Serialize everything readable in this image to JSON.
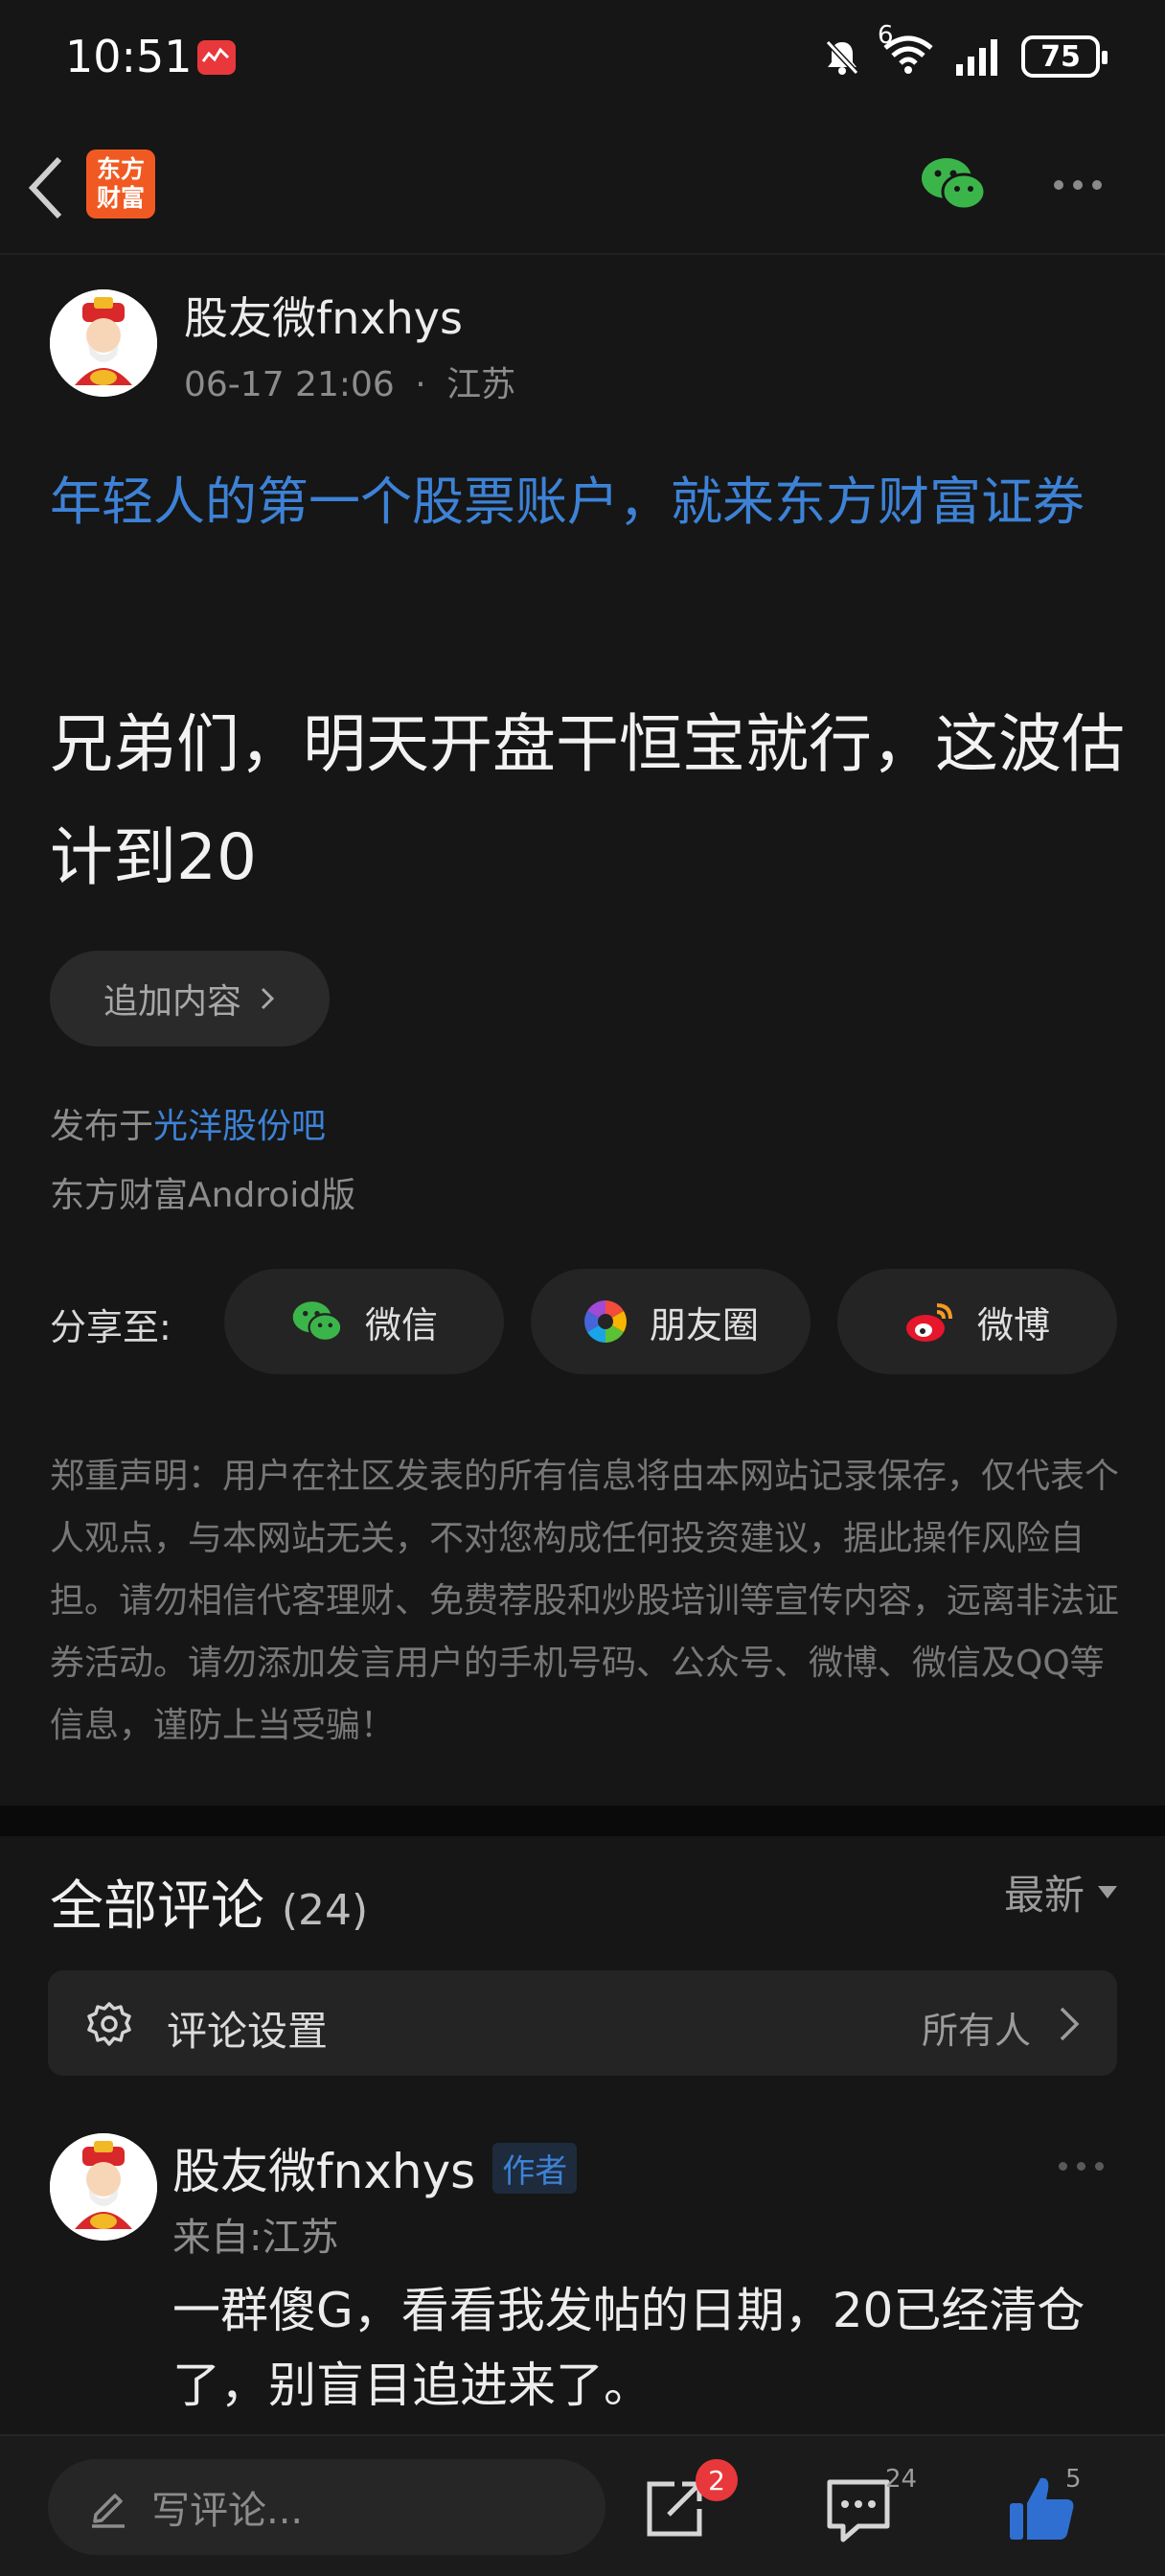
{
  "status_bar": {
    "time": "10:51",
    "battery": "75",
    "network_sup": "6"
  },
  "nav": {
    "logo_line1": "东方",
    "logo_line2": "财富"
  },
  "post": {
    "author": "股友微fnxhys",
    "date": "06-17 21:06",
    "separator": "·",
    "location": "江苏",
    "ad_text": "年轻人的第一个股票账户，就来东方财富证券",
    "body": "兄弟们，明天开盘干恒宝就行，这波估计到20",
    "append_label": "追加内容",
    "published_prefix": "发布于",
    "published_bar": "光洋股份吧",
    "client": "东方财富Android版"
  },
  "share": {
    "label": "分享至:",
    "options": [
      "微信",
      "朋友圈",
      "微博"
    ]
  },
  "disclaimer": "郑重声明：用户在社区发表的所有信息将由本网站记录保存，仅代表个人观点，与本网站无关，不对您构成任何投资建议，据此操作风险自担。请勿相信代客理财、免费荐股和炒股培训等宣传内容，远离非法证券活动。请勿添加发言用户的手机号码、公众号、微博、微信及QQ等信息，谨防上当受骗！",
  "comments": {
    "title": "全部评论",
    "count": "(24)",
    "sort_label": "最新",
    "settings_label": "评论设置",
    "settings_value": "所有人",
    "items": [
      {
        "author": "股友微fnxhys",
        "badge": "作者",
        "from": "来自:江苏",
        "text": "一群傻G，看看我发帖的日期，20已经清仓了，别盲目追进来了。"
      }
    ]
  },
  "bottom_bar": {
    "placeholder": "写评论...",
    "share_badge": "2",
    "comment_count": "24",
    "like_count": "5"
  },
  "colors": {
    "accent_blue": "#3d82d6",
    "brand_orange": "#f05a22",
    "badge_red": "#e8383b",
    "like_blue": "#2f6fd1"
  }
}
